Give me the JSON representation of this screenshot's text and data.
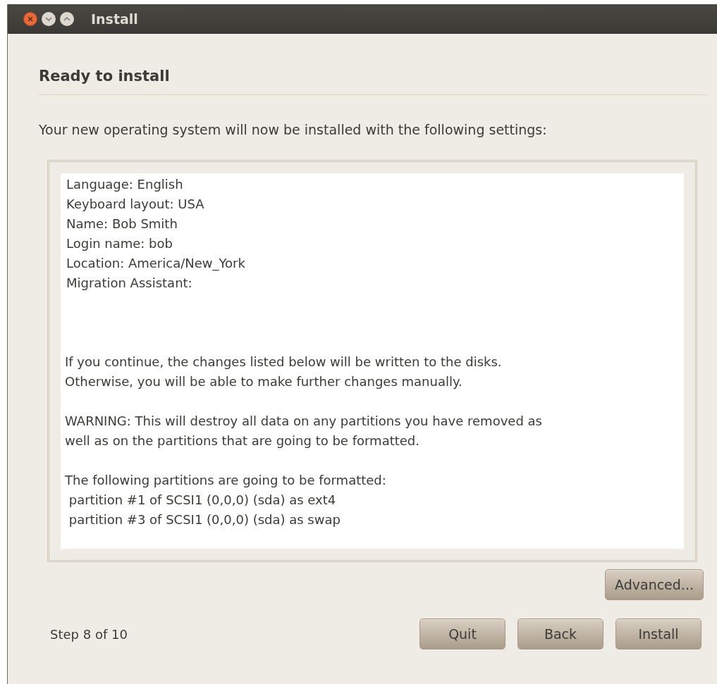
{
  "window": {
    "title": "Install"
  },
  "heading": "Ready to install",
  "intro": "Your new operating system will now be installed with the following settings:",
  "summary": {
    "settings": [
      "Language: English",
      "Keyboard layout: USA",
      "Name: Bob Smith",
      "Login name: bob",
      "Location: America/New_York",
      "Migration Assistant:"
    ],
    "paragraphs": [
      [
        "If you continue, the changes listed below will be written to the disks.",
        "Otherwise, you will be able to make further changes manually."
      ],
      [
        "WARNING: This will destroy all data on any partitions you have removed as",
        "well as on the partitions that are going to be formatted."
      ],
      [
        "The following partitions are going to be formatted:",
        " partition #1 of SCSI1 (0,0,0) (sda) as ext4",
        " partition #3 of SCSI1 (0,0,0) (sda) as swap"
      ]
    ]
  },
  "advanced_button": "Advanced...",
  "step": "Step 8 of 10",
  "buttons": [
    "Quit",
    "Back",
    "Install"
  ]
}
